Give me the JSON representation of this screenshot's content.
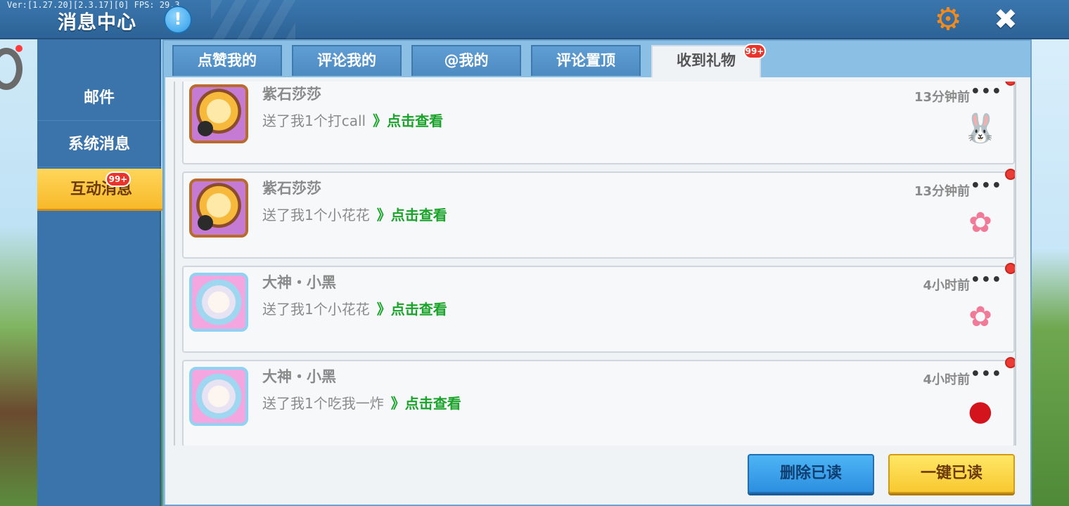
{
  "header": {
    "version": "Ver:[1.27.20][2.3.17][0] FPS: 29.3",
    "title": "消息中心",
    "info_icon": "exclamation-icon",
    "settings_icon": "gear-icon",
    "close_icon": "close-icon"
  },
  "sidebar": {
    "items": [
      {
        "label": "邮件"
      },
      {
        "label": "系统消息"
      },
      {
        "label": "互动消息",
        "active": true,
        "badge": "99+"
      }
    ]
  },
  "tabs": [
    {
      "label": "点赞我的"
    },
    {
      "label": "评论我的"
    },
    {
      "label": "@我的"
    },
    {
      "label": "评论置顶"
    },
    {
      "label": "收到礼物",
      "active": true,
      "badge": "99+"
    }
  ],
  "messages": [
    {
      "name": "紫石莎莎",
      "text": "送了我1个打call",
      "link": "》点击查看",
      "time": "13分钟前",
      "more": "•••",
      "gift_icon": "rabbit-gift-icon",
      "unread": true
    },
    {
      "name": "紫石莎莎",
      "text": "送了我1个小花花",
      "link": "》点击查看",
      "time": "13分钟前",
      "more": "•••",
      "gift_icon": "flower-gift-icon",
      "unread": true
    },
    {
      "name": "大神・小黑",
      "text": "送了我1个小花花",
      "link": "》点击查看",
      "time": "4小时前",
      "more": "•••",
      "gift_icon": "flower-gift-icon",
      "unread": true
    },
    {
      "name": "大神・小黑",
      "text": "送了我1个吃我一炸",
      "link": "》点击查看",
      "time": "4小时前",
      "more": "•••",
      "gift_icon": "bomb-gift-icon",
      "unread": true
    }
  ],
  "actions": {
    "delete_read": "删除已读",
    "mark_all_read": "一键已读"
  },
  "colors": {
    "header_blue": "#3a76ad",
    "active_yellow": "#f8b92a",
    "link_green": "#1aa32a",
    "badge_red": "#e8342b"
  }
}
